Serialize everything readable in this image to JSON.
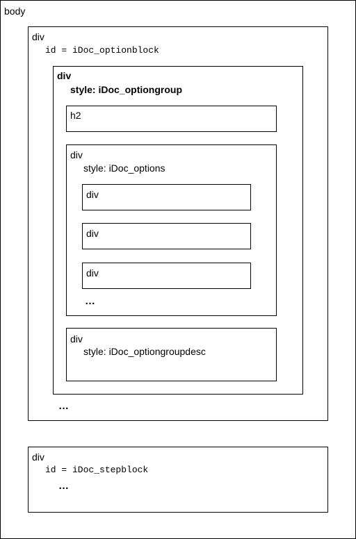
{
  "diagram": {
    "body": {
      "label": "body"
    },
    "optionblock": {
      "tag": "div",
      "attr": "id = iDoc_optionblock",
      "more": "…"
    },
    "optiongroup": {
      "tag": "div",
      "attr": "style: iDoc_optiongroup"
    },
    "h2": {
      "tag": "h2"
    },
    "options": {
      "tag": "div",
      "attr": "style: iDoc_options",
      "children": [
        {
          "tag": "div"
        },
        {
          "tag": "div"
        },
        {
          "tag": "div"
        }
      ],
      "more": "…"
    },
    "optiongroupdesc": {
      "tag": "div",
      "attr": "style: iDoc_optiongroupdesc"
    },
    "stepblock": {
      "tag": "div",
      "attr": "id = iDoc_stepblock",
      "more": "…"
    }
  }
}
